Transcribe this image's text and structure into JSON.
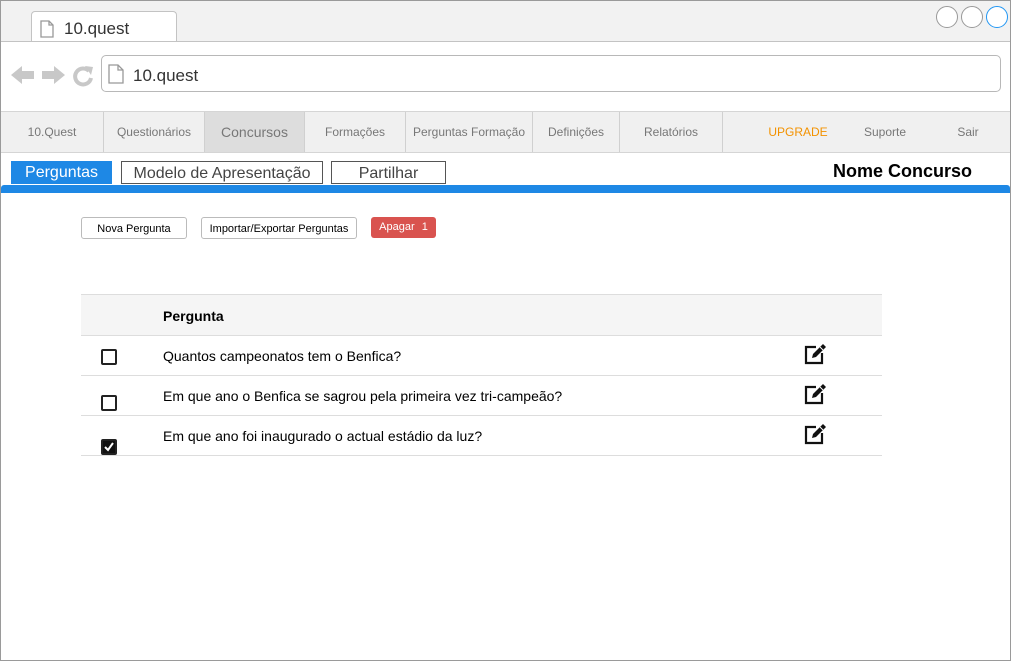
{
  "browser": {
    "tab_title": "10.quest",
    "url": "10.quest"
  },
  "nav": {
    "items": [
      {
        "label": "10.Quest"
      },
      {
        "label": "Questionários"
      },
      {
        "label": "Concursos"
      },
      {
        "label": "Formações"
      },
      {
        "label": "Perguntas Formação"
      },
      {
        "label": "Definições"
      },
      {
        "label": "Relatórios"
      },
      {
        "label": "UPGRADE"
      },
      {
        "label": "Suporte"
      },
      {
        "label": "Sair"
      }
    ],
    "active": "Concursos",
    "upgrade_color": "#f39200"
  },
  "tabs": [
    {
      "label": "Perguntas"
    },
    {
      "label": "Modelo de Apresentação"
    },
    {
      "label": "Partilhar"
    }
  ],
  "page_title": "Nome Concurso",
  "accent_color": "#1e88e5",
  "actions": {
    "new": "Nova Pergunta",
    "import_export": "Importar/Exportar Perguntas",
    "delete": "Apagar",
    "delete_count": "1",
    "delete_color": "#d9534f"
  },
  "table": {
    "header": "Pergunta",
    "rows": [
      {
        "question": "Quantos campeonatos tem o Benfica?",
        "checked": false
      },
      {
        "question": "Em que ano o Benfica se sagrou pela primeira vez tri-campeão?",
        "checked": false
      },
      {
        "question": "Em que ano foi inaugurado o actual estádio da luz?",
        "checked": true
      }
    ]
  }
}
